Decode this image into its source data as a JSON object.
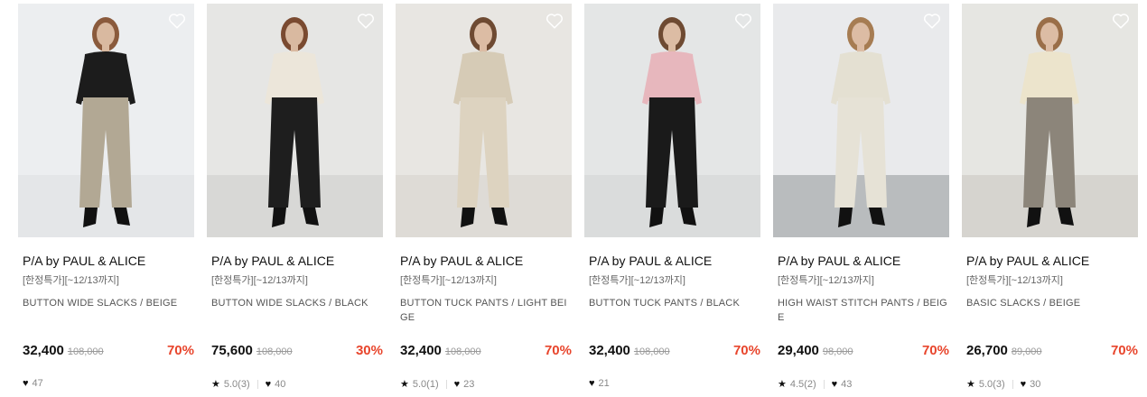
{
  "products": [
    {
      "brand": "P/A by PAUL & ALICE",
      "tag": "[한정특가][~12/13까지]",
      "name": "BUTTON WIDE SLACKS / BEIGE",
      "price": "32,400",
      "original_price": "108,000",
      "discount": "70%",
      "rating": "",
      "likes": "47",
      "photo": {
        "bg": "#eceef0",
        "floor": "#e4e6e8",
        "top": "#1c1c1c",
        "bottom": "#b2a894",
        "skin": "#d9b9a0",
        "hair": "#8a5a3c"
      }
    },
    {
      "brand": "P/A by PAUL & ALICE",
      "tag": "[한정특가][~12/13까지]",
      "name": "BUTTON WIDE SLACKS / BLACK",
      "price": "75,600",
      "original_price": "108,000",
      "discount": "30%",
      "rating": "5.0(3)",
      "likes": "40",
      "photo": {
        "bg": "#e6e6e4",
        "floor": "#d8d8d6",
        "top": "#ece6da",
        "bottom": "#1e1e1e",
        "skin": "#d9b9a0",
        "hair": "#7a4a30"
      }
    },
    {
      "brand": "P/A by PAUL & ALICE",
      "tag": "[한정특가][~12/13까지]",
      "name": "BUTTON TUCK PANTS / LIGHT BEIGE",
      "price": "32,400",
      "original_price": "108,000",
      "discount": "70%",
      "rating": "5.0(1)",
      "likes": "23",
      "photo": {
        "bg": "#e8e6e2",
        "floor": "#dedbd6",
        "top": "#d6cbb6",
        "bottom": "#ddd3c0",
        "skin": "#dcbca4",
        "hair": "#6e4a32"
      }
    },
    {
      "brand": "P/A by PAUL & ALICE",
      "tag": "[한정특가][~12/13까지]",
      "name": "BUTTON TUCK PANTS / BLACK",
      "price": "32,400",
      "original_price": "108,000",
      "discount": "70%",
      "rating": "",
      "likes": "21",
      "photo": {
        "bg": "#e4e6e6",
        "floor": "#dadcdc",
        "top": "#e7b7bd",
        "bottom": "#1a1a1a",
        "skin": "#dcbca4",
        "hair": "#6e4a32"
      }
    },
    {
      "brand": "P/A by PAUL & ALICE",
      "tag": "[한정특가][~12/13까지]",
      "name": "HIGH WAIST STITCH PANTS / BEIGE",
      "price": "29,400",
      "original_price": "98,000",
      "discount": "70%",
      "rating": "4.5(2)",
      "likes": "43",
      "photo": {
        "bg": "#e9eaec",
        "floor": "#b9bcbe",
        "top": "#e4e0d2",
        "bottom": "#e6e2d6",
        "skin": "#dcbca4",
        "hair": "#a67c52"
      }
    },
    {
      "brand": "P/A by PAUL & ALICE",
      "tag": "[한정특가][~12/13까지]",
      "name": "BASIC SLACKS / BEIGE",
      "price": "26,700",
      "original_price": "89,000",
      "discount": "70%",
      "rating": "5.0(3)",
      "likes": "30",
      "photo": {
        "bg": "#e6e6e2",
        "floor": "#d6d4cf",
        "top": "#ece4cc",
        "bottom": "#8c857a",
        "skin": "#dcbca4",
        "hair": "#9a6e48"
      }
    }
  ],
  "icons": {
    "wishlist": "heart-outline-icon",
    "like": "heart-filled-icon",
    "rating": "star-icon"
  },
  "colors": {
    "discount": "#e8452c"
  }
}
